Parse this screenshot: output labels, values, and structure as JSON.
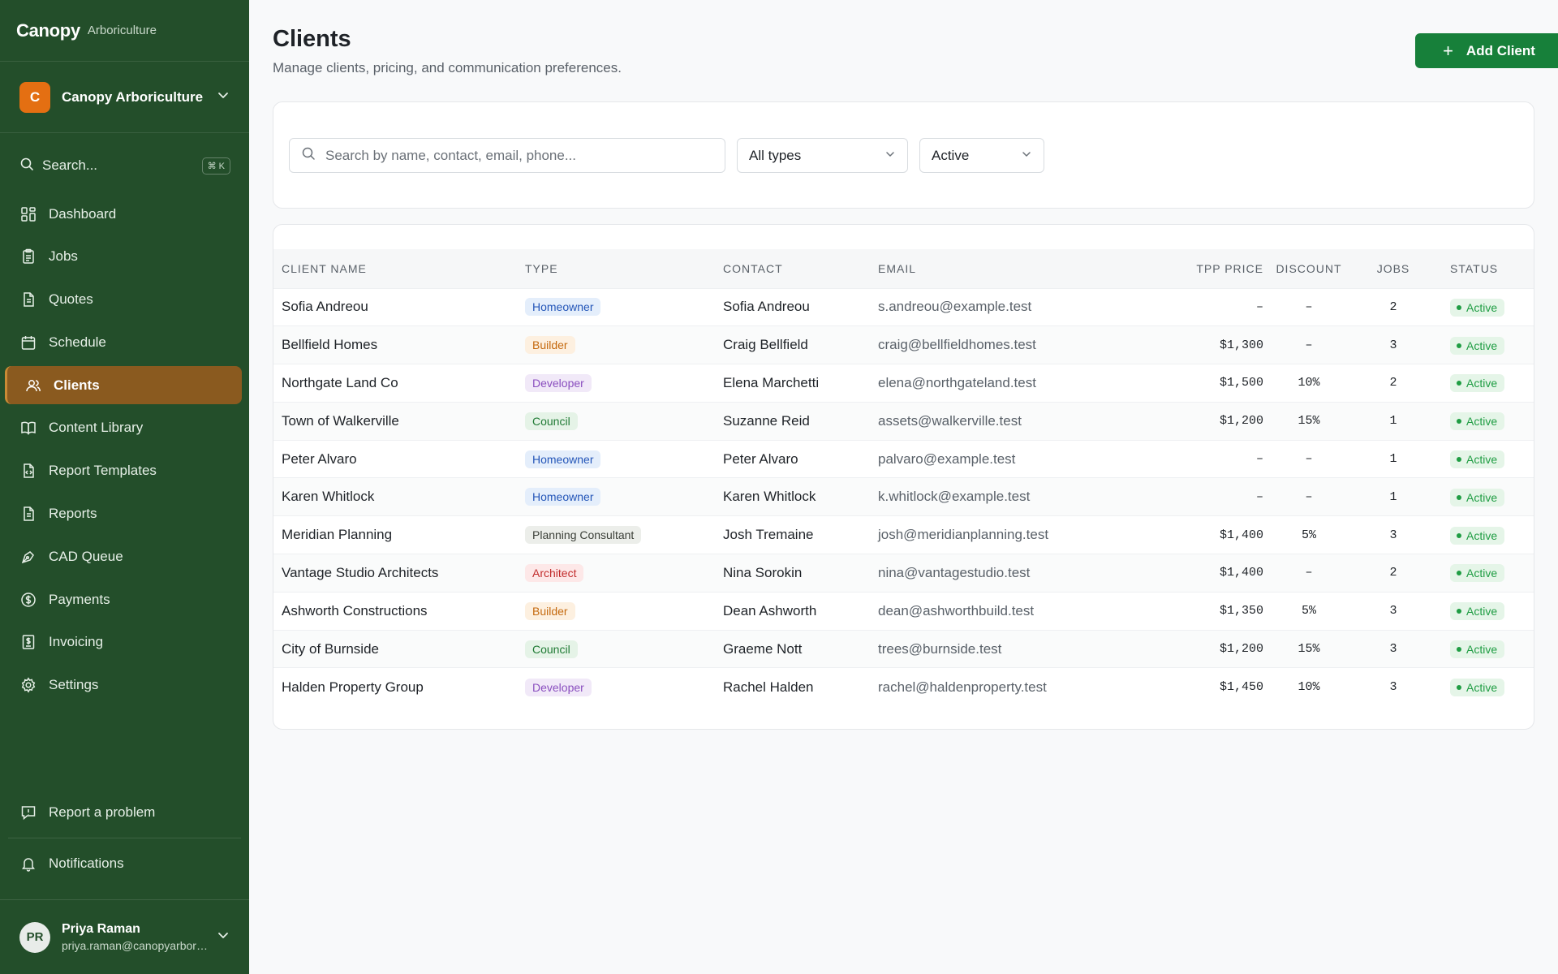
{
  "brand": {
    "name": "Canopy",
    "sub": "Arboriculture"
  },
  "org": {
    "initial": "C",
    "name": "Canopy Arboriculture"
  },
  "sidebar_search": {
    "label": "Search...",
    "shortcut": "⌘ K"
  },
  "nav": [
    {
      "label": "Dashboard",
      "icon": "dashboard-icon",
      "active": false
    },
    {
      "label": "Jobs",
      "icon": "clipboard-icon",
      "active": false
    },
    {
      "label": "Quotes",
      "icon": "document-icon",
      "active": false
    },
    {
      "label": "Schedule",
      "icon": "calendar-icon",
      "active": false
    },
    {
      "label": "Clients",
      "icon": "users-icon",
      "active": true
    },
    {
      "label": "Content Library",
      "icon": "book-icon",
      "active": false
    },
    {
      "label": "Report Templates",
      "icon": "template-icon",
      "active": false
    },
    {
      "label": "Reports",
      "icon": "report-icon",
      "active": false
    },
    {
      "label": "CAD Queue",
      "icon": "pen-tool-icon",
      "active": false
    },
    {
      "label": "Payments",
      "icon": "dollar-circle-icon",
      "active": false
    },
    {
      "label": "Invoicing",
      "icon": "invoice-icon",
      "active": false
    },
    {
      "label": "Settings",
      "icon": "gear-icon",
      "active": false
    }
  ],
  "bottom": {
    "report_problem": "Report a problem",
    "notifications": "Notifications"
  },
  "user": {
    "initials": "PR",
    "name": "Priya Raman",
    "email": "priya.raman@canopyarboriculture.test"
  },
  "header": {
    "title": "Clients",
    "subtitle": "Manage clients, pricing, and communication preferences.",
    "add_label": "Add Client"
  },
  "filters": {
    "search_placeholder": "Search by name, contact, email, phone...",
    "type_value": "All types",
    "status_value": "Active"
  },
  "table": {
    "columns": [
      "CLIENT NAME",
      "TYPE",
      "CONTACT",
      "EMAIL",
      "TPP PRICE",
      "DISCOUNT",
      "JOBS",
      "STATUS"
    ],
    "rows": [
      {
        "name": "Sofia Andreou",
        "type": "Homeowner",
        "contact": "Sofia Andreou",
        "email": "s.andreou@example.test",
        "tpp": "–",
        "discount": "–",
        "jobs": "2",
        "status": "Active"
      },
      {
        "name": "Bellfield Homes",
        "type": "Builder",
        "contact": "Craig Bellfield",
        "email": "craig@bellfieldhomes.test",
        "tpp": "$1,300",
        "discount": "–",
        "jobs": "3",
        "status": "Active"
      },
      {
        "name": "Northgate Land Co",
        "type": "Developer",
        "contact": "Elena Marchetti",
        "email": "elena@northgateland.test",
        "tpp": "$1,500",
        "discount": "10%",
        "jobs": "2",
        "status": "Active"
      },
      {
        "name": "Town of Walkerville",
        "type": "Council",
        "contact": "Suzanne Reid",
        "email": "assets@walkerville.test",
        "tpp": "$1,200",
        "discount": "15%",
        "jobs": "1",
        "status": "Active"
      },
      {
        "name": "Peter Alvaro",
        "type": "Homeowner",
        "contact": "Peter Alvaro",
        "email": "palvaro@example.test",
        "tpp": "–",
        "discount": "–",
        "jobs": "1",
        "status": "Active"
      },
      {
        "name": "Karen Whitlock",
        "type": "Homeowner",
        "contact": "Karen Whitlock",
        "email": "k.whitlock@example.test",
        "tpp": "–",
        "discount": "–",
        "jobs": "1",
        "status": "Active"
      },
      {
        "name": "Meridian Planning",
        "type": "Planning Consultant",
        "contact": "Josh Tremaine",
        "email": "josh@meridianplanning.test",
        "tpp": "$1,400",
        "discount": "5%",
        "jobs": "3",
        "status": "Active"
      },
      {
        "name": "Vantage Studio Architects",
        "type": "Architect",
        "contact": "Nina Sorokin",
        "email": "nina@vantagestudio.test",
        "tpp": "$1,400",
        "discount": "–",
        "jobs": "2",
        "status": "Active"
      },
      {
        "name": "Ashworth Constructions",
        "type": "Builder",
        "contact": "Dean Ashworth",
        "email": "dean@ashworthbuild.test",
        "tpp": "$1,350",
        "discount": "5%",
        "jobs": "3",
        "status": "Active"
      },
      {
        "name": "City of Burnside",
        "type": "Council",
        "contact": "Graeme Nott",
        "email": "trees@burnside.test",
        "tpp": "$1,200",
        "discount": "15%",
        "jobs": "3",
        "status": "Active"
      },
      {
        "name": "Halden Property Group",
        "type": "Developer",
        "contact": "Rachel Halden",
        "email": "rachel@haldenproperty.test",
        "tpp": "$1,450",
        "discount": "10%",
        "jobs": "3",
        "status": "Active"
      }
    ]
  },
  "colors": {
    "sidebar": "#234e2a",
    "accent": "#17803a",
    "active_nav": "#8a5a1f",
    "org_avatar": "#e46f12"
  }
}
